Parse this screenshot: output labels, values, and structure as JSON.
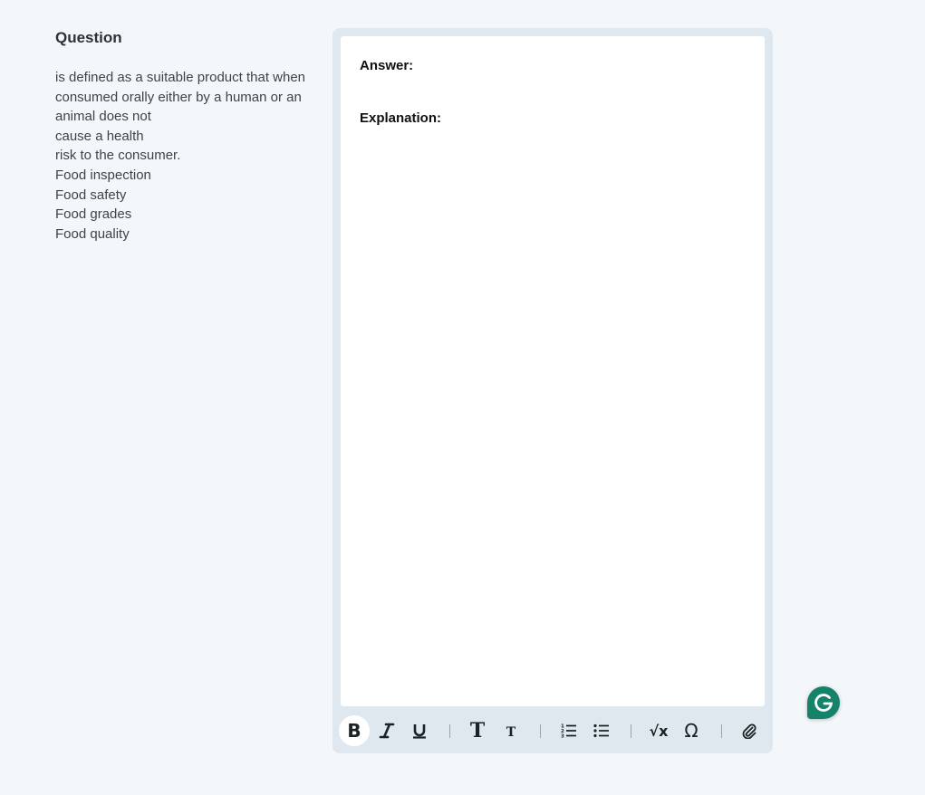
{
  "question": {
    "title": "Question",
    "lines": [
      "is defined as a suitable product that when",
      "consumed orally either by a human or an animal does not",
      "cause a health",
      "risk to the consumer.",
      "Food inspection",
      "Food safety",
      "Food grades",
      "Food quality"
    ]
  },
  "editor": {
    "answer_label": "Answer:",
    "explanation_label": "Explanation:"
  },
  "toolbar": {
    "buttons": [
      {
        "name": "bold",
        "glyph": "B",
        "active": true
      },
      {
        "name": "italic",
        "glyph": "I"
      },
      {
        "name": "underline",
        "glyph": "U"
      },
      {
        "name": "heading-large",
        "glyph": "T"
      },
      {
        "name": "heading-small",
        "glyph": "T"
      },
      {
        "name": "ordered-list",
        "glyph": ""
      },
      {
        "name": "bullet-list",
        "glyph": ""
      },
      {
        "name": "equation",
        "glyph": "√x"
      },
      {
        "name": "special-character",
        "glyph": "Ω"
      },
      {
        "name": "attach",
        "glyph": ""
      }
    ]
  },
  "colors": {
    "page_bg": "#f3f7fa",
    "editor_frame": "#e0e8ef",
    "grammarly": "#15826a"
  }
}
